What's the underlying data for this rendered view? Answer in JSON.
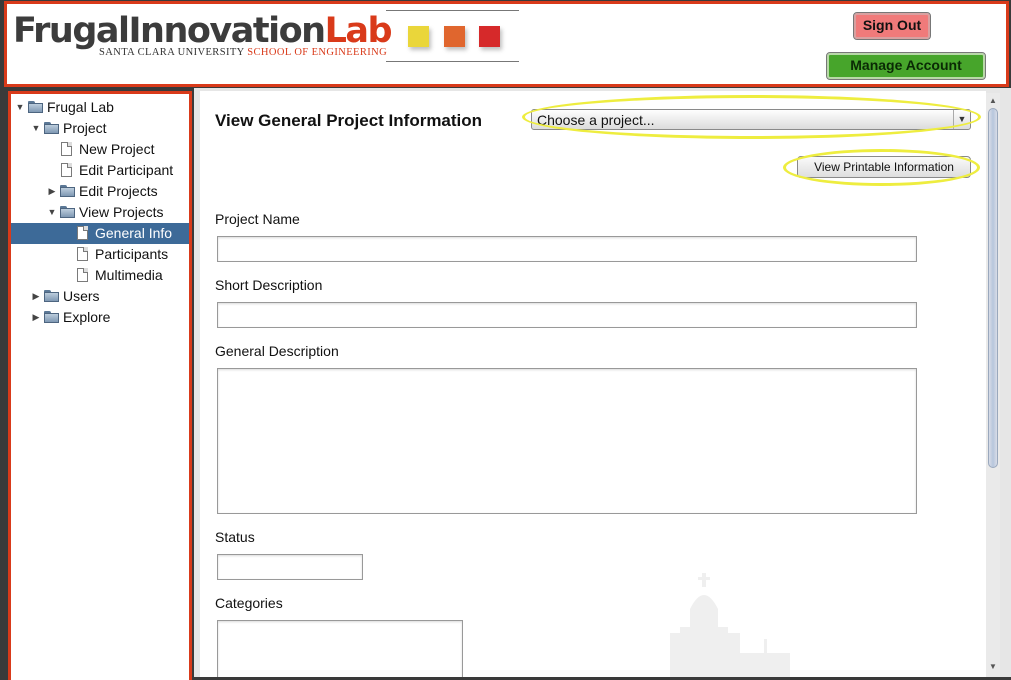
{
  "header": {
    "logo_part1": "Frugal",
    "logo_part2": "Innovation",
    "logo_part3": "Lab",
    "logo_sub1": "SANTA CLARA UNIVERSITY",
    "logo_sub2": "SCHOOL OF ENGINEERING",
    "square_colors": [
      "#ead63a",
      "#e0662e",
      "#d6292a"
    ],
    "sign_out": "Sign Out",
    "manage_account": "Manage Account"
  },
  "tree": [
    {
      "label": "Frugal Lab",
      "type": "folder",
      "expanded": true,
      "level": 0
    },
    {
      "label": "Project",
      "type": "folder",
      "expanded": true,
      "level": 1
    },
    {
      "label": "New Project",
      "type": "doc",
      "level": 2
    },
    {
      "label": "Edit Participant",
      "type": "doc",
      "level": 2
    },
    {
      "label": "Edit Projects",
      "type": "folder",
      "expanded": false,
      "level": 2
    },
    {
      "label": "View Projects",
      "type": "folder",
      "expanded": true,
      "level": 2
    },
    {
      "label": "General Info",
      "type": "doc",
      "level": 3,
      "selected": true
    },
    {
      "label": "Participants",
      "type": "doc",
      "level": 3
    },
    {
      "label": "Multimedia",
      "type": "doc",
      "level": 3
    },
    {
      "label": "Users",
      "type": "folder",
      "expanded": false,
      "level": 1
    },
    {
      "label": "Explore",
      "type": "folder",
      "expanded": false,
      "level": 1
    }
  ],
  "main": {
    "title": "View General Project Information",
    "project_select": "Choose a project...",
    "print_button": "View Printable Information",
    "fields": {
      "project_name": "Project Name",
      "short_description": "Short Description",
      "general_description": "General Description",
      "status": "Status",
      "categories": "Categories"
    },
    "highlight_color": "#eeed3f"
  }
}
